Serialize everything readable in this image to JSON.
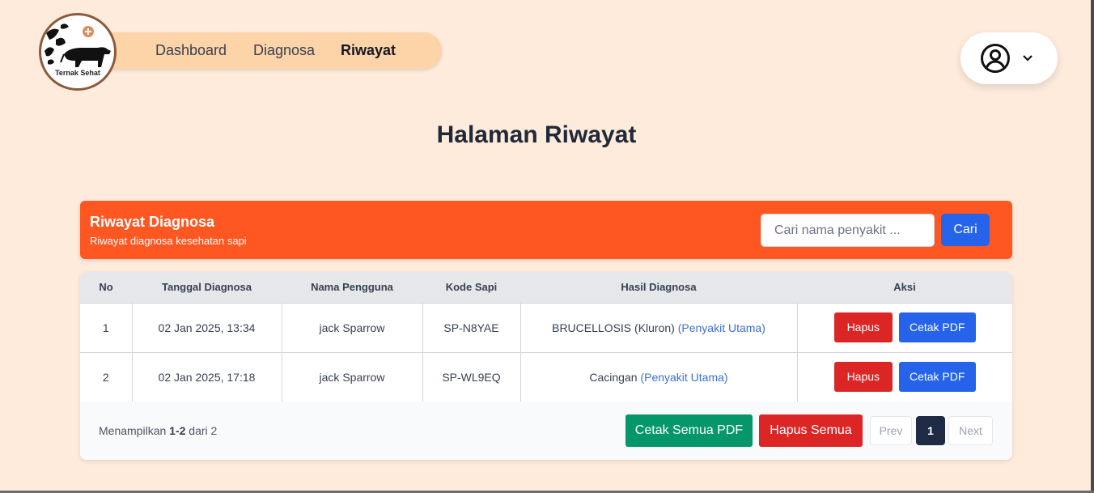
{
  "nav": {
    "logo_text": "Ternak Sehat",
    "links": [
      {
        "label": "Dashboard",
        "active": false
      },
      {
        "label": "Diagnosa",
        "active": false
      },
      {
        "label": "Riwayat",
        "active": true
      }
    ],
    "user_icon": "user-circle-icon",
    "dropdown_icon": "chevron-down-icon"
  },
  "page": {
    "title": "Halaman Riwayat"
  },
  "card": {
    "title": "Riwayat Diagnosa",
    "subtitle": "Riwayat diagnosa kesehatan sapi",
    "search_placeholder": "Cari nama penyakit ...",
    "search_button": "Cari"
  },
  "table": {
    "headers": [
      "No",
      "Tanggal Diagnosa",
      "Nama Pengguna",
      "Kode Sapi",
      "Hasil Diagnosa",
      "Aksi"
    ],
    "rows": [
      {
        "no": "1",
        "date": "02 Jan 2025, 13:34",
        "user": "jack Sparrow",
        "code": "SP-N8YAE",
        "result": "BRUCELLOSIS (Kluron)",
        "tag": "(Penyakit Utama)",
        "delete": "Hapus",
        "pdf": "Cetak PDF"
      },
      {
        "no": "2",
        "date": "02 Jan 2025, 17:18",
        "user": "jack Sparrow",
        "code": "SP-WL9EQ",
        "result": "Cacingan",
        "tag": "(Penyakit Utama)",
        "delete": "Hapus",
        "pdf": "Cetak PDF"
      }
    ]
  },
  "footer": {
    "showing_prefix": "Menampilkan",
    "showing_range": "1-2",
    "showing_suffix": "dari 2",
    "print_all": "Cetak Semua PDF",
    "delete_all": "Hapus Semua",
    "prev": "Prev",
    "current_page": "1",
    "next": "Next"
  },
  "colors": {
    "background": "#FEEBDC",
    "nav_pill": "#FDD3A8",
    "header_orange": "#FF5722",
    "primary_blue": "#2563EB",
    "danger_red": "#DC2626",
    "success_green": "#059669",
    "link_blue": "#3B6FD8"
  }
}
